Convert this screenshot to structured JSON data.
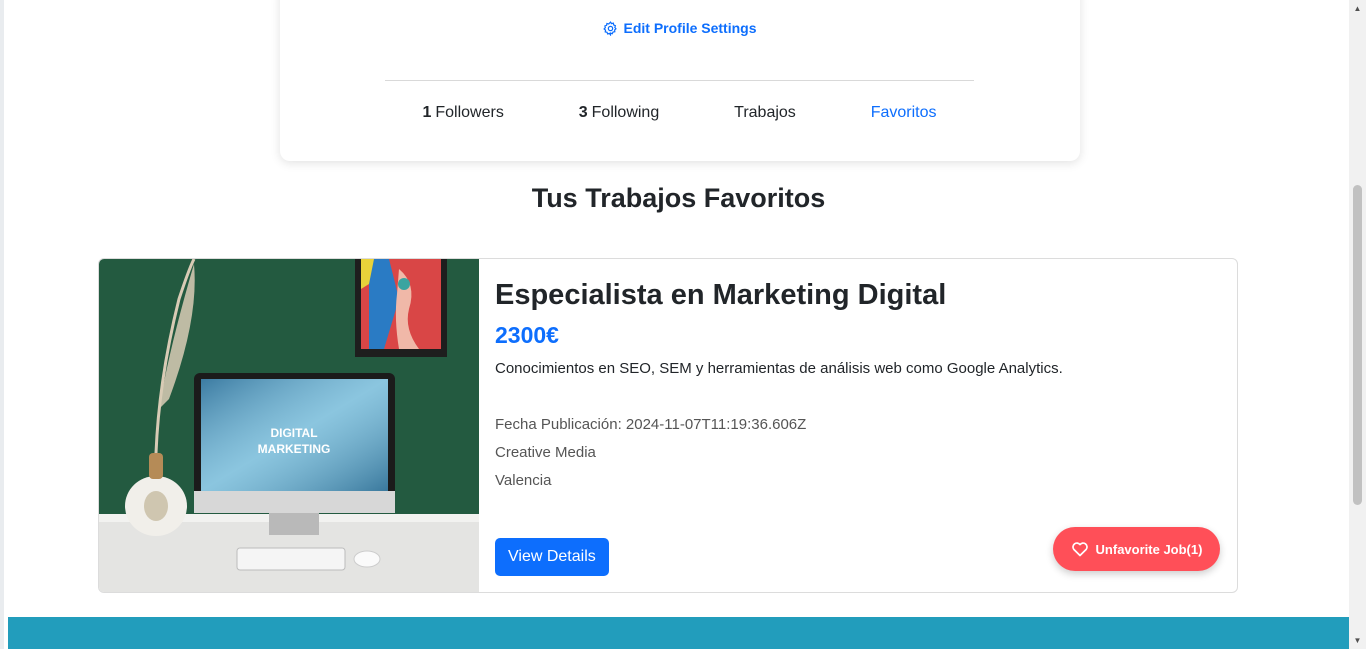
{
  "profile": {
    "edit_settings_label": "Edit Profile Settings",
    "stats": {
      "followers_count": "1",
      "followers_label": "Followers",
      "following_count": "3",
      "following_label": "Following",
      "trabajos_label": "Trabajos",
      "favoritos_label": "Favoritos"
    }
  },
  "section_title": "Tus Trabajos Favoritos",
  "job": {
    "title": "Especialista en Marketing Digital",
    "salary": "2300€",
    "description": "Conocimientos en SEO, SEM y herramientas de análisis web como Google Analytics.",
    "date": "Fecha Publicación: 2024-11-07T11:19:36.606Z",
    "company": "Creative Media",
    "location": "Valencia",
    "image_text_line1": "DIGITAL",
    "image_text_line2": "MARKETING",
    "view_details_label": "View Details",
    "unfavorite_label": "Unfavorite Job(1)"
  },
  "colors": {
    "accent": "#0d6efd",
    "unfavorite": "#ff4f58",
    "footer": "#229dbc"
  },
  "icons": {
    "edit": "gear-icon",
    "unfavorite": "heart-icon"
  }
}
